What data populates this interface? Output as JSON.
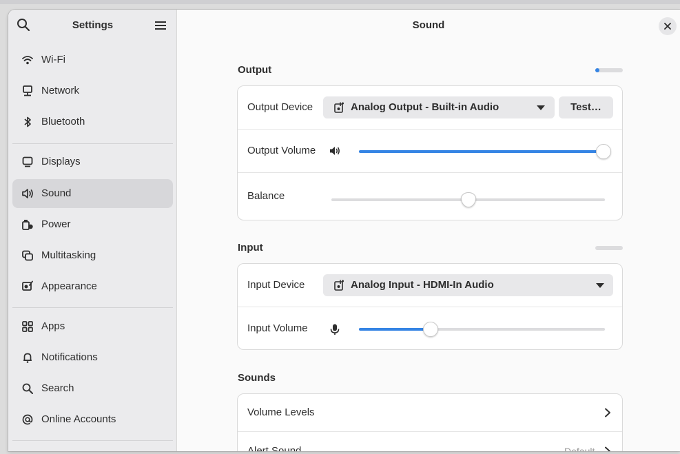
{
  "sidebar": {
    "title": "Settings",
    "items": [
      {
        "label": "Wi-Fi",
        "icon": "wifi-icon"
      },
      {
        "label": "Network",
        "icon": "network-icon"
      },
      {
        "label": "Bluetooth",
        "icon": "bluetooth-icon"
      },
      {
        "label": "Displays",
        "icon": "display-icon"
      },
      {
        "label": "Sound",
        "icon": "sound-icon"
      },
      {
        "label": "Power",
        "icon": "power-icon"
      },
      {
        "label": "Multitasking",
        "icon": "multitasking-icon"
      },
      {
        "label": "Appearance",
        "icon": "appearance-icon"
      },
      {
        "label": "Apps",
        "icon": "apps-icon"
      },
      {
        "label": "Notifications",
        "icon": "bell-icon"
      },
      {
        "label": "Search",
        "icon": "search-icon"
      },
      {
        "label": "Online Accounts",
        "icon": "at-icon"
      }
    ],
    "active": "Sound"
  },
  "header": {
    "title": "Sound"
  },
  "output": {
    "title": "Output",
    "level": 0.15,
    "device_label": "Output Device",
    "device_value": "Analog Output - Built-in Audio",
    "test_label": "Test…",
    "volume_label": "Output Volume",
    "volume": 1.0,
    "balance_label": "Balance",
    "balance": 0.5
  },
  "input": {
    "title": "Input",
    "level": 0.0,
    "device_label": "Input Device",
    "device_value": "Analog Input - HDMI-In Audio",
    "volume_label": "Input Volume",
    "volume": 0.29
  },
  "sounds": {
    "title": "Sounds",
    "volume_levels_label": "Volume Levels",
    "alert_sound_label": "Alert Sound",
    "alert_sound_value": "Default"
  },
  "colors": {
    "accent": "#3584e4",
    "sidebar_bg": "#ebebed",
    "active_item": "#d7d7da"
  }
}
